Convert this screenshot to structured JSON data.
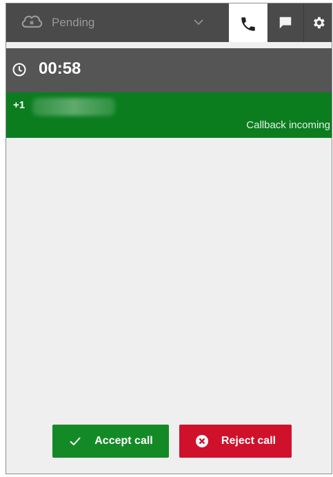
{
  "header": {
    "status_label": "Pending",
    "tabs": [
      {
        "name": "phone",
        "icon": "phone-icon",
        "active": true
      },
      {
        "name": "chat",
        "icon": "chat-icon",
        "active": false
      },
      {
        "name": "settings",
        "icon": "gear-icon",
        "active": false
      }
    ]
  },
  "timer": {
    "value": "00:58",
    "icon": "clock-icon"
  },
  "contact": {
    "number_prefix": "+1",
    "status": "Callback incoming"
  },
  "actions": {
    "accept_label": "Accept call",
    "reject_label": "Reject call"
  },
  "colors": {
    "header_bg": "#4a4a4a",
    "timer_bg": "#555555",
    "contact_bg": "#0b7d1f",
    "accept_bg": "#148a27",
    "reject_bg": "#d0112b",
    "body_bg": "#efefef"
  }
}
